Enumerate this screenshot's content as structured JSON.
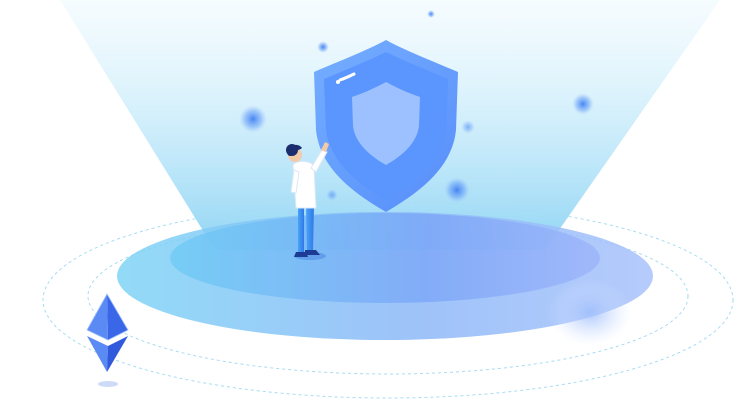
{
  "illustration": {
    "subject": "security-shield",
    "icons": {
      "shield": "shield-icon",
      "crystal": "ethereum-crystal-icon"
    }
  },
  "colors": {
    "background": "#ffffff",
    "beam": "#8fd6f6",
    "platform_light": "#7fd0f4",
    "platform_dark": "#8aa6f8",
    "shield_outer": "#5e9bff",
    "shield_inner": "#9cc4ff",
    "person_shirt": "#ffffff",
    "person_pants": "#3d8bf2",
    "person_hair": "#1b2d6e",
    "crystal": "#3c6cf0",
    "orb": "#4c8df5"
  }
}
